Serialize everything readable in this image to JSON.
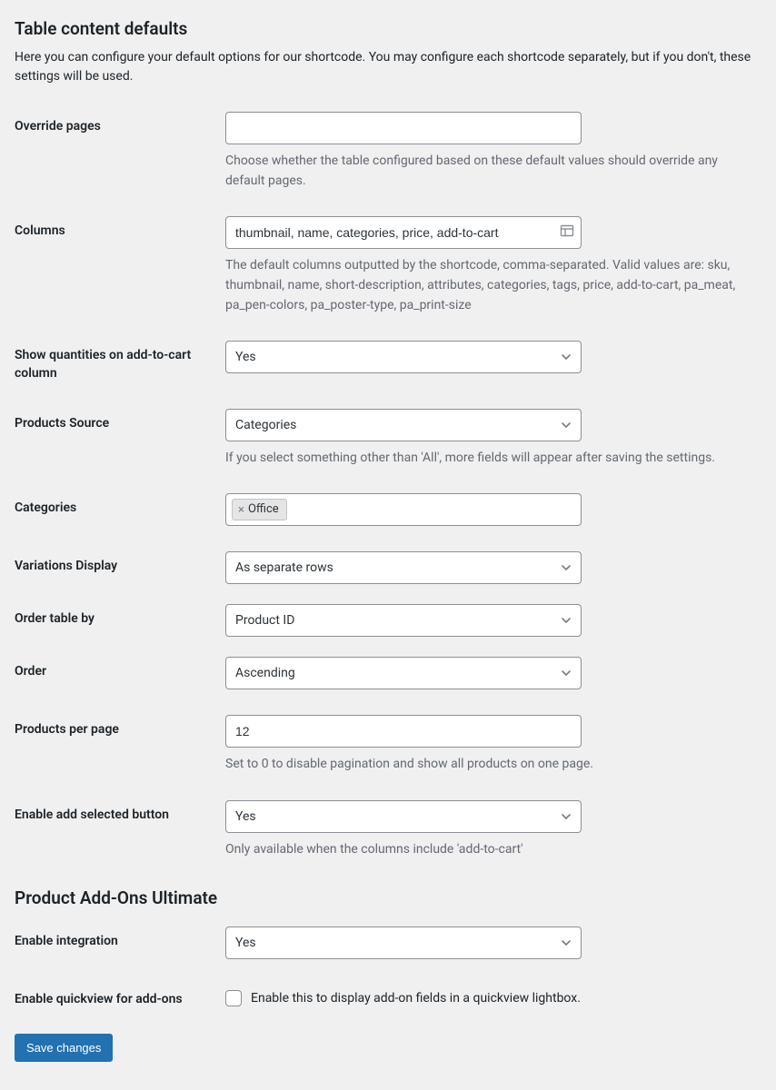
{
  "section1": {
    "title": "Table content defaults",
    "desc": "Here you can configure your default options for our shortcode. You may configure each shortcode separately, but if you don't, these settings will be used."
  },
  "fields": {
    "override_pages": {
      "label": "Override pages",
      "value": "",
      "help": "Choose whether the table configured based on these default values should override any default pages."
    },
    "columns": {
      "label": "Columns",
      "value": "thumbnail, name, categories, price, add-to-cart",
      "help": "The default columns outputted by the shortcode, comma-separated. Valid values are: sku, thumbnail, name, short-description, attributes, categories, tags, price, add-to-cart, pa_meat, pa_pen-colors, pa_poster-type, pa_print-size"
    },
    "show_quantities": {
      "label": "Show quantities on add-to-cart column",
      "value": "Yes"
    },
    "products_source": {
      "label": "Products Source",
      "value": "Categories",
      "help": "If you select something other than 'All', more fields will appear after saving the settings."
    },
    "categories": {
      "label": "Categories",
      "tag": "Office"
    },
    "variations_display": {
      "label": "Variations Display",
      "value": "As separate rows"
    },
    "order_by": {
      "label": "Order table by",
      "value": "Product ID"
    },
    "order": {
      "label": "Order",
      "value": "Ascending"
    },
    "per_page": {
      "label": "Products per page",
      "value": "12",
      "help": "Set to 0 to disable pagination and show all products on one page."
    },
    "enable_add_selected": {
      "label": "Enable add selected button",
      "value": "Yes",
      "help": "Only available when the columns include 'add-to-cart'"
    }
  },
  "section2": {
    "title": "Product Add-Ons Ultimate"
  },
  "fields2": {
    "enable_integration": {
      "label": "Enable integration",
      "value": "Yes"
    },
    "enable_quickview": {
      "label": "Enable quickview for add-ons",
      "checkbox_label": "Enable this to display add-on fields in a quickview lightbox."
    }
  },
  "submit": {
    "label": "Save changes"
  }
}
